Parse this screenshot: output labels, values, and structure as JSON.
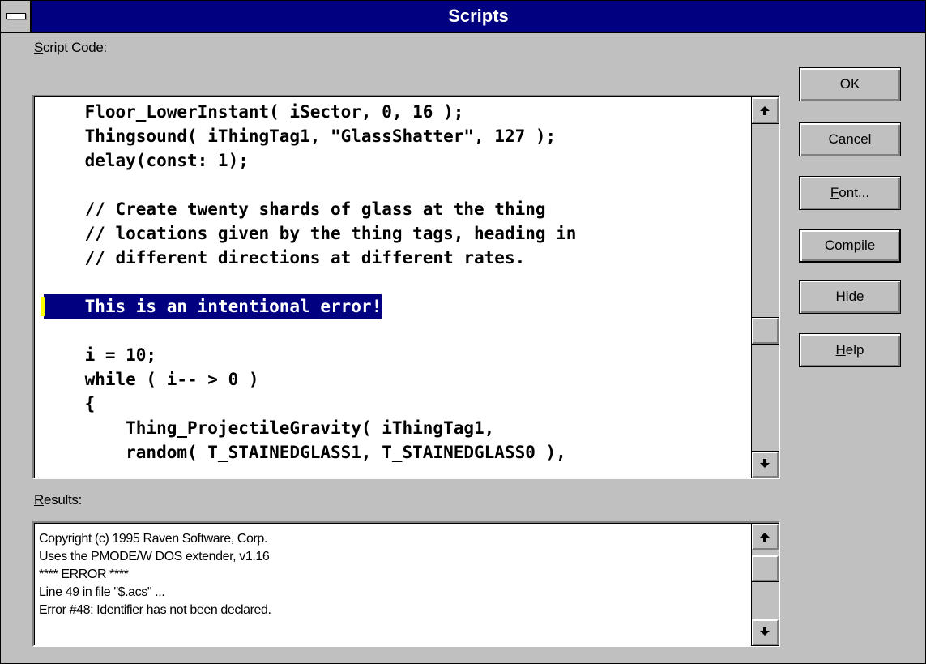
{
  "window": {
    "title": "Scripts"
  },
  "script_code": {
    "label_mnemonic": "S",
    "label_rest": "cript Code:",
    "lines": [
      "    Floor_LowerInstant( iSector, 0, 16 );",
      "    Thingsound( iThingTag1, \"GlassShatter\", 127 );",
      "    delay(const: 1);",
      "",
      "    // Create twenty shards of glass at the thing",
      "    // locations given by the thing tags, heading in",
      "    // different directions at different rates.",
      "",
      "    This is an intentional error!",
      "",
      "    i = 10;",
      "    while ( i-- > 0 )",
      "    {",
      "        Thing_ProjectileGravity( iThingTag1,",
      "        random( T_STAINEDGLASS1, T_STAINEDGLASS0 ),"
    ],
    "selected_line_index": 8
  },
  "results": {
    "label_mnemonic": "R",
    "label_rest": "esults:",
    "lines": [
      "Copyright (c) 1995 Raven Software, Corp.",
      "Uses the PMODE/W DOS extender, v1.16",
      "**** ERROR ****",
      "Line 49 in file \"$.acs\" ...",
      "Error #48: Identifier has not been declared."
    ]
  },
  "buttons": {
    "ok": {
      "label": "OK"
    },
    "cancel": {
      "label": "Cancel"
    },
    "font": {
      "mnemonic": "F",
      "rest": "ont..."
    },
    "compile": {
      "mnemonic": "C",
      "rest": "ompile"
    },
    "hide": {
      "pre": "Hi",
      "mnemonic": "d",
      "rest": "e"
    },
    "help": {
      "mnemonic": "H",
      "rest": "elp"
    }
  },
  "colors": {
    "title_bar": "#000080",
    "selection": "#000080",
    "face": "#c0c0c0",
    "caret": "#ffff00"
  }
}
